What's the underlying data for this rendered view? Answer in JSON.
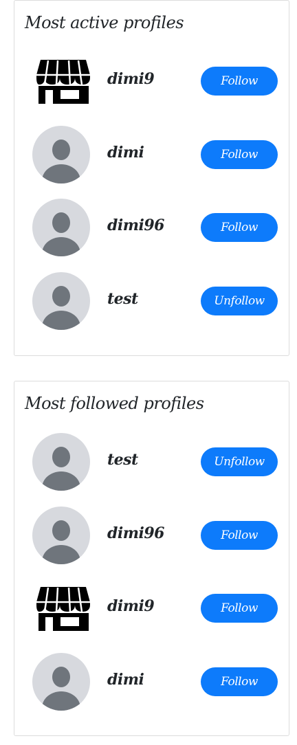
{
  "colors": {
    "accent": "#0d7bfb",
    "avatar_bg": "#d7d9de",
    "avatar_fg": "#6f757c",
    "card_border": "#dcdcdc"
  },
  "most_active": {
    "title": "Most active profiles",
    "profiles": [
      {
        "name": "dimi9",
        "avatar": "store-icon",
        "button": "Follow"
      },
      {
        "name": "dimi",
        "avatar": "default-avatar-icon",
        "button": "Follow"
      },
      {
        "name": "dimi96",
        "avatar": "default-avatar-icon",
        "button": "Follow"
      },
      {
        "name": "test",
        "avatar": "default-avatar-icon",
        "button": "Unfollow"
      }
    ]
  },
  "most_followed": {
    "title": "Most followed profiles",
    "profiles": [
      {
        "name": "test",
        "avatar": "default-avatar-icon",
        "button": "Unfollow"
      },
      {
        "name": "dimi96",
        "avatar": "default-avatar-icon",
        "button": "Follow"
      },
      {
        "name": "dimi9",
        "avatar": "store-icon",
        "button": "Follow"
      },
      {
        "name": "dimi",
        "avatar": "default-avatar-icon",
        "button": "Follow"
      }
    ]
  }
}
